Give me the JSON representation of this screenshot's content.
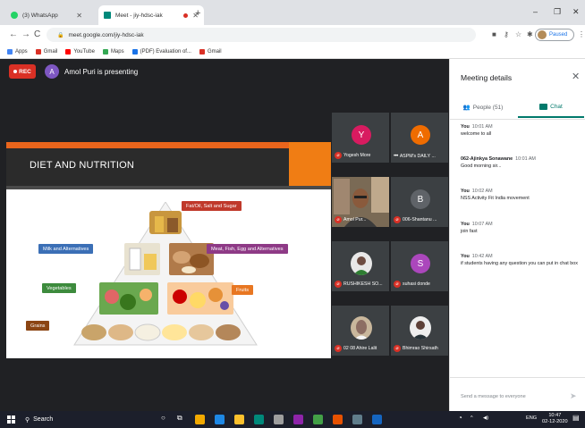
{
  "browser": {
    "tabs": [
      {
        "label": "(3) WhatsApp",
        "active": false
      },
      {
        "label": "Meet - jiy-hdsc-iak",
        "active": true
      }
    ],
    "new_tab": "+",
    "window_controls": {
      "minimize": "–",
      "restore": "❐",
      "close": "✕"
    },
    "nav": {
      "back": "←",
      "forward": "→",
      "reload": "C"
    },
    "url": "meet.google.com/jiy-hdsc-iak",
    "profile_label": "Paused",
    "bookmarks": [
      "Apps",
      "Gmail",
      "YouTube",
      "Maps",
      "(PDF) Evaluation of...",
      "Gmail"
    ]
  },
  "meeting": {
    "rec_label": "REC",
    "presenter_initial": "A",
    "presenter_text": "Amol Puri is presenting",
    "slide": {
      "title": "DIET AND NUTRITION",
      "labels": {
        "fat": "Fat/Oil, Salt and Sugar",
        "milk": "Milk and Alternatives",
        "meat": "Meat, Fish, Egg and Alternatives",
        "veg": "Vegetables",
        "fruits": "Fruits",
        "grains": "Grains"
      }
    },
    "participants": [
      {
        "initial": "Y",
        "name": "Yogesh More",
        "color": "#d81b60",
        "muted": true
      },
      {
        "initial": "A",
        "name": "ASPM's DAILY ...",
        "color": "#ef6c00",
        "muted": false
      },
      {
        "initial": "",
        "name": "Amol Pur...",
        "color": "",
        "muted": true
      },
      {
        "initial": "B",
        "name": "006-Shantanu ...",
        "color": "#5f6368",
        "muted": true
      },
      {
        "initial": "",
        "name": "RUSHIKESH SO...",
        "color": "",
        "muted": true
      },
      {
        "initial": "S",
        "name": "suhasi donde",
        "color": "#ab47bc",
        "muted": true
      },
      {
        "initial": "",
        "name": "02 08 Ahire Lalit",
        "color": "",
        "muted": true
      },
      {
        "initial": "",
        "name": "Bhimrao Shirsath",
        "color": "",
        "muted": true
      }
    ]
  },
  "panel": {
    "title": "Meeting details",
    "close": "✕",
    "tab_people": "People (51)",
    "tab_chat": "Chat",
    "messages": [
      {
        "who": "You",
        "time": "10:01 AM",
        "text": "welcome to all"
      },
      {
        "who": "062-Ajinkya Sonawane",
        "time": "10:01 AM",
        "text": "Good morning sir..."
      },
      {
        "who": "You",
        "time": "10:02 AM",
        "text": "NSS Activity Fit India movement"
      },
      {
        "who": "You",
        "time": "10:07 AM",
        "text": "join fast"
      },
      {
        "who": "You",
        "time": "10:42 AM",
        "text": "if students having any question you can put in chat box"
      }
    ],
    "input_placeholder": "Send a message to everyone"
  },
  "taskbar": {
    "search_label": "Search",
    "tray_lang": "ENG",
    "time": "10:47",
    "date": "02-12-2020"
  }
}
